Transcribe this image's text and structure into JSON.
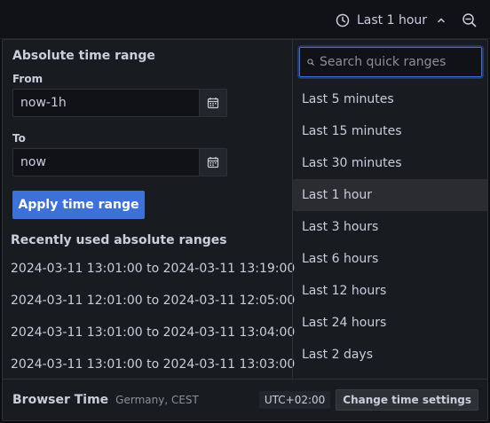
{
  "topbar": {
    "time_picker_label": "Last 1 hour"
  },
  "absolute": {
    "title": "Absolute time range",
    "from_label": "From",
    "from_value": "now-1h",
    "to_label": "To",
    "to_value": "now",
    "apply_label": "Apply time range"
  },
  "recent": {
    "title": "Recently used absolute ranges",
    "items": [
      "2024-03-11 13:01:00 to 2024-03-11 13:19:00",
      "2024-03-11 12:01:00 to 2024-03-11 12:05:00",
      "2024-03-11 13:01:00 to 2024-03-11 13:04:00",
      "2024-03-11 13:01:00 to 2024-03-11 13:03:00"
    ]
  },
  "quick": {
    "search_placeholder": "Search quick ranges",
    "items": [
      "Last 5 minutes",
      "Last 15 minutes",
      "Last 30 minutes",
      "Last 1 hour",
      "Last 3 hours",
      "Last 6 hours",
      "Last 12 hours",
      "Last 24 hours",
      "Last 2 days"
    ],
    "active_index": 3
  },
  "footer": {
    "browser_time": "Browser Time",
    "timezone_name": "Germany, CEST",
    "utc_offset": "UTC+02:00",
    "change_settings_label": "Change time settings"
  },
  "colors": {
    "accent": "#3d71d9",
    "panel_bg": "#181b1f",
    "page_bg": "#111217",
    "active_item_bg": "#2a2c31"
  },
  "icons": {
    "time_picker": "clock-icon",
    "time_picker_caret": "chevron-up-icon",
    "zoom": "zoom-out-icon",
    "calendar": "calendar-icon",
    "search": "search-icon"
  }
}
